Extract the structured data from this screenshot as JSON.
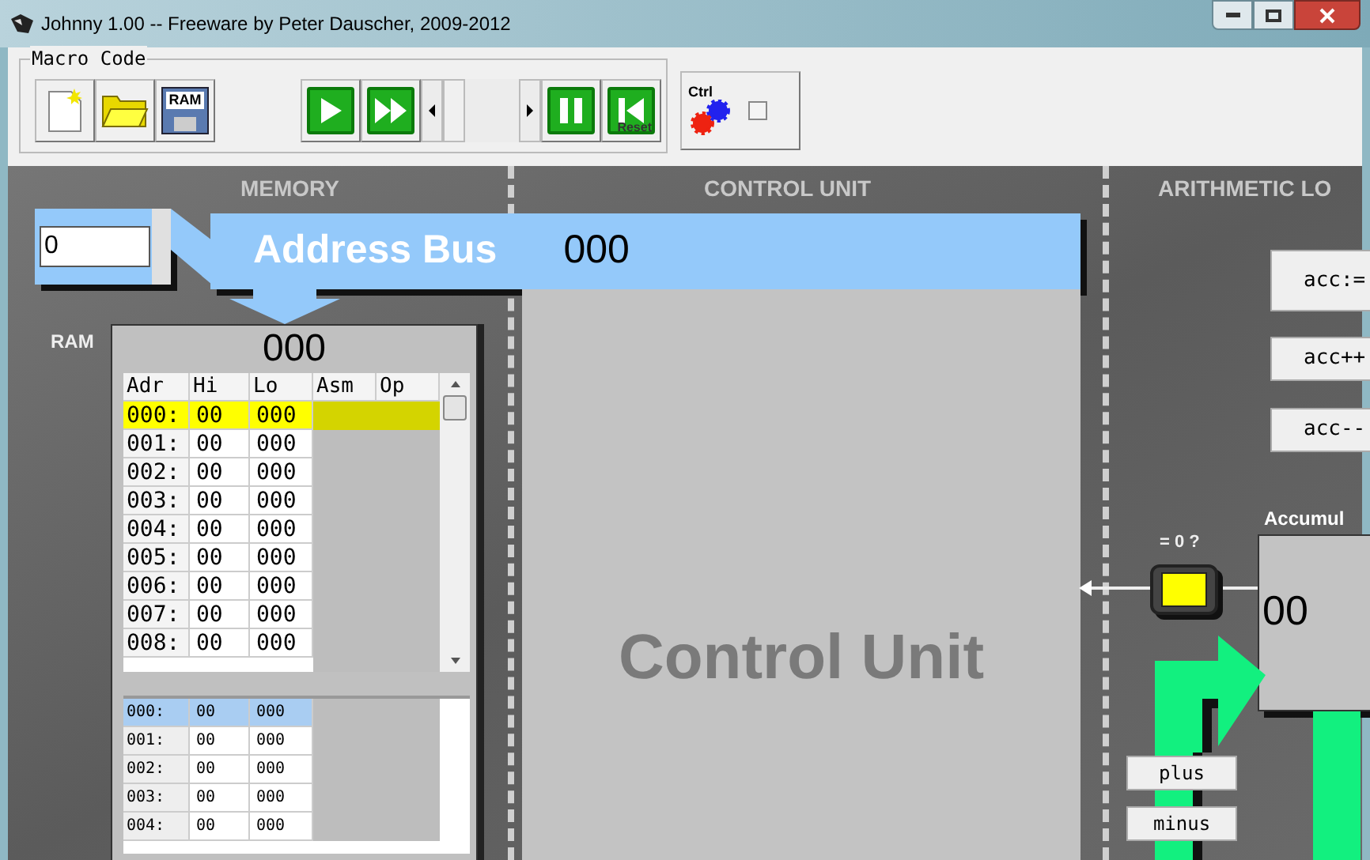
{
  "window": {
    "title": "Johnny 1.00 --  Freeware by Peter Dauscher, 2009-2012"
  },
  "toolbar": {
    "group_label": "Macro Code",
    "file_buttons": [
      {
        "kind": "new"
      },
      {
        "kind": "open"
      },
      {
        "kind": "ram",
        "label": "RAM"
      }
    ],
    "run_buttons": [
      {
        "kind": "play"
      },
      {
        "kind": "fast"
      }
    ],
    "step_buttons": [
      {
        "kind": "pause"
      },
      {
        "kind": "reset",
        "label": "Reset"
      }
    ],
    "control_toggle": {
      "label": "Ctrl",
      "checked": false
    }
  },
  "memory": {
    "heading": "MEMORY",
    "address_input": "0",
    "ram_label": "RAM",
    "ram_value": "000",
    "table": {
      "columns": [
        "Adr",
        "Hi",
        "Lo",
        "Asm",
        "Op"
      ],
      "rows": [
        {
          "adr": "000:",
          "hi": "00",
          "lo": "000",
          "selected": true
        },
        {
          "adr": "001:",
          "hi": "00",
          "lo": "000",
          "selected": false
        },
        {
          "adr": "002:",
          "hi": "00",
          "lo": "000",
          "selected": false
        },
        {
          "adr": "003:",
          "hi": "00",
          "lo": "000",
          "selected": false
        },
        {
          "adr": "004:",
          "hi": "00",
          "lo": "000",
          "selected": false
        },
        {
          "adr": "005:",
          "hi": "00",
          "lo": "000",
          "selected": false
        },
        {
          "adr": "006:",
          "hi": "00",
          "lo": "000",
          "selected": false
        },
        {
          "adr": "007:",
          "hi": "00",
          "lo": "000",
          "selected": false
        },
        {
          "adr": "008:",
          "hi": "00",
          "lo": "000",
          "selected": false
        }
      ]
    },
    "micro_table": {
      "rows": [
        {
          "adr": "000:",
          "hi": "00",
          "lo": "000",
          "selected": true
        },
        {
          "adr": "001:",
          "hi": "00",
          "lo": "000",
          "selected": false
        },
        {
          "adr": "002:",
          "hi": "00",
          "lo": "000",
          "selected": false
        },
        {
          "adr": "003:",
          "hi": "00",
          "lo": "000",
          "selected": false
        },
        {
          "adr": "004:",
          "hi": "00",
          "lo": "000",
          "selected": false
        }
      ]
    }
  },
  "address_bus": {
    "label": "Address Bus",
    "value": "000"
  },
  "control_unit": {
    "heading": "CONTROL UNIT",
    "label": "Control Unit"
  },
  "alu": {
    "heading": "ARITHMETIC LO",
    "buttons": [
      "acc:=",
      "acc++",
      "acc--"
    ],
    "accumulator_label": "Accumul",
    "accumulator_value": "00",
    "zero_label": "= 0 ?",
    "zero_flag": {
      "on": true
    },
    "op_buttons": [
      "plus",
      "minus"
    ]
  }
}
